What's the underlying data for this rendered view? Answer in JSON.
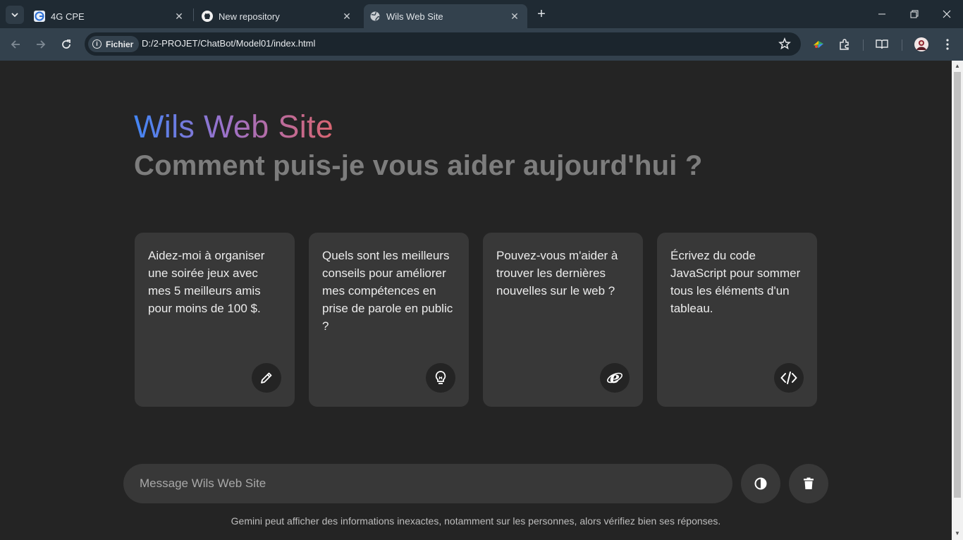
{
  "browser": {
    "tabs": [
      {
        "title": "4G CPE",
        "icon": "cpe-globe-icon"
      },
      {
        "title": "New repository",
        "icon": "github-icon"
      },
      {
        "title": "Wils Web Site",
        "icon": "globe-icon",
        "active": true
      }
    ],
    "address": {
      "chip_label": "Fichier",
      "url": "D:/2-PROJET/ChatBot/Model01/index.html"
    }
  },
  "page": {
    "title": "Wils Web Site",
    "subtitle": "Comment puis-je vous aider aujourd'hui ?",
    "cards": [
      {
        "text": "Aidez-moi à organiser une soirée jeux avec mes 5 meilleurs amis pour moins de 100 $.",
        "icon": "pencil-icon"
      },
      {
        "text": "Quels sont les meilleurs conseils pour améliorer mes compétences en prise de parole en public ?",
        "icon": "lightbulb-icon"
      },
      {
        "text": "Pouvez-vous m'aider à trouver les dernières nouvelles sur le web ?",
        "icon": "internet-explorer-icon"
      },
      {
        "text": "Écrivez du code JavaScript pour sommer tous les éléments d'un tableau.",
        "icon": "code-icon"
      }
    ],
    "input": {
      "placeholder": "Message Wils Web Site",
      "value": ""
    },
    "disclaimer": "Gemini peut afficher des informations inexactes, notamment sur les personnes, alors vérifiez bien ses réponses."
  },
  "colors": {
    "page_bg": "#242424",
    "card_bg": "#383838",
    "title_gradient": [
      "#4285f4",
      "#9b72cb",
      "#d96570"
    ],
    "subtitle": "#7d7d7d"
  }
}
